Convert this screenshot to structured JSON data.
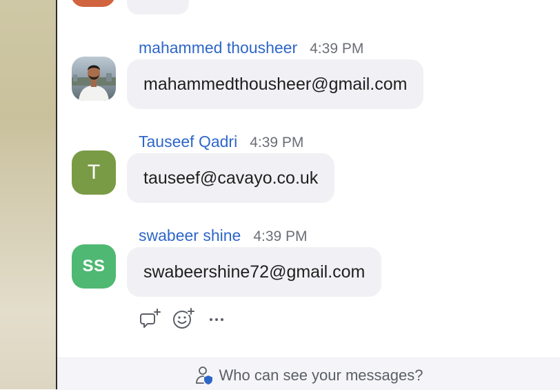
{
  "messages": [
    {
      "sender": "mahammed thousheer",
      "time": "4:39 PM",
      "text": "mahammedthousheer@gmail.com",
      "avatar_type": "photo"
    },
    {
      "sender": "Tauseef Qadri",
      "time": "4:39 PM",
      "text": "tauseef@cavayo.co.uk",
      "avatar_type": "letter",
      "avatar_text": "T",
      "avatar_color": "#7a9b45"
    },
    {
      "sender": "swabeer shine",
      "time": "4:39 PM",
      "text": "swabeershine72@gmail.com",
      "avatar_type": "initials",
      "avatar_text": "SS",
      "avatar_color": "#4fb873"
    }
  ],
  "actions": [
    {
      "icon": "reply-thread-icon"
    },
    {
      "icon": "add-reaction-icon"
    },
    {
      "icon": "more-options-icon"
    }
  ],
  "footer": {
    "privacy_text": "Who can see your messages?",
    "icon": "person-shield-icon"
  },
  "colors": {
    "sender_name": "#2e66c8",
    "bubble_bg": "#f1f1f5",
    "footer_bg": "#f5f5f9",
    "shield": "#2e66c8"
  }
}
